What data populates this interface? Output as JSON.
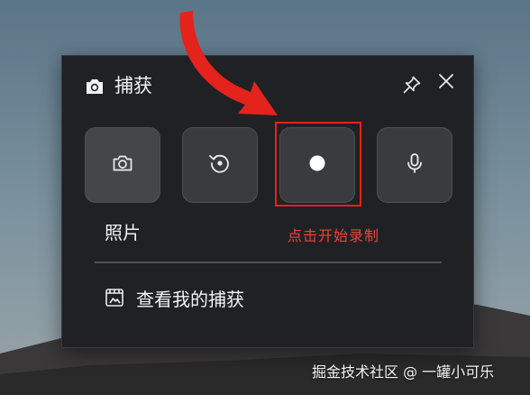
{
  "panel": {
    "title": "捕获",
    "title_icon": "camera-icon",
    "pin_icon": "pin-icon",
    "close_icon": "close-icon"
  },
  "modes": [
    {
      "name": "photo",
      "icon": "camera-icon"
    },
    {
      "name": "replay",
      "icon": "replay-icon"
    },
    {
      "name": "record",
      "icon": "record-icon"
    },
    {
      "name": "microphone",
      "icon": "microphone-icon"
    }
  ],
  "selected_mode_label": "照片",
  "annotation": {
    "hint": "点击开始录制",
    "highlight_color": "#e3231c",
    "arrow_color": "#e3231c"
  },
  "gallery": {
    "label": "查看我的捕获",
    "icon": "gallery-icon"
  },
  "watermark": "掘金技术社区 @ 一罐小可乐"
}
